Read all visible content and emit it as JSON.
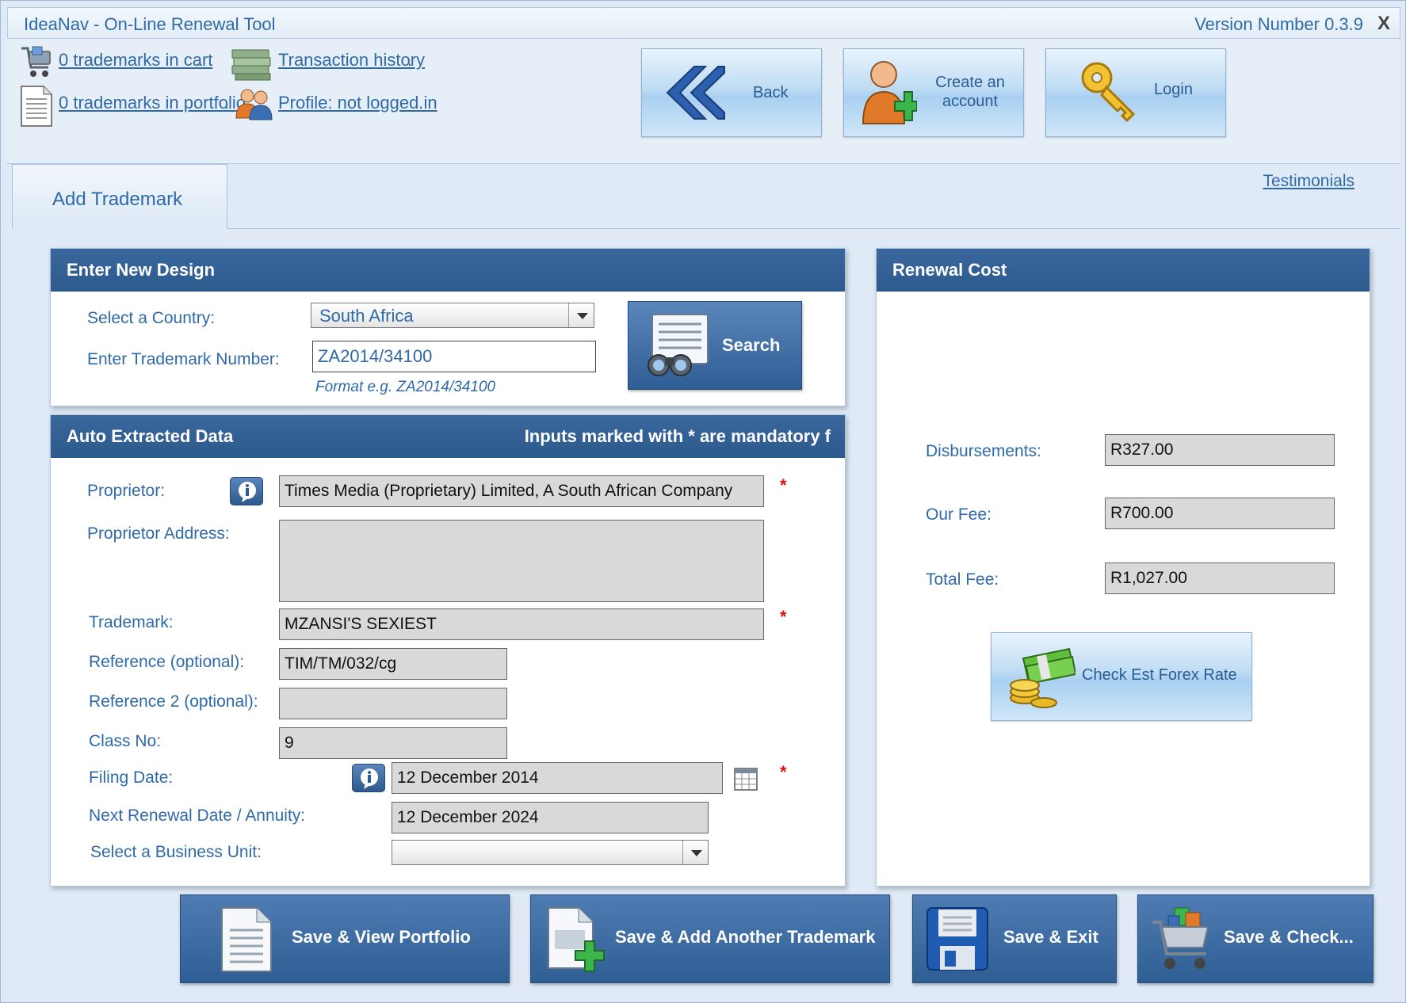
{
  "window": {
    "title": "IdeaNav - On-Line Renewal Tool",
    "version": "Version Number 0.3.9",
    "close": "X"
  },
  "top": {
    "cart_link": "0 trademarks in cart",
    "portfolio_link": "0 trademarks in portfolio",
    "history_link": "Transaction history",
    "profile_link": "Profile: not logged in",
    "back_label": "Back",
    "create_label_1": "Create an",
    "create_label_2": "account",
    "login_label": "Login"
  },
  "tabs": {
    "add_trademark": "Add Trademark",
    "testimonials": "Testimonials"
  },
  "design": {
    "title": "Enter New Design",
    "country_label": "Select a Country:",
    "country_value": "South Africa",
    "tm_label": "Enter Trademark Number:",
    "tm_value": "ZA2014/34100",
    "format_hint": "Format e.g. ZA2014/34100",
    "search_label": "Search"
  },
  "auto": {
    "title": "Auto Extracted Data",
    "mandatory_note": "Inputs marked with * are mandatory f",
    "proprietor_label": "Proprietor:",
    "proprietor_value": "Times Media (Proprietary) Limited, A South African Company",
    "address_label": "Proprietor Address:",
    "address_value": "",
    "trademark_label": "Trademark:",
    "trademark_value": "MZANSI'S SEXIEST",
    "ref_label": "Reference (optional):",
    "ref_value": "TIM/TM/032/cg",
    "ref2_label": "Reference 2 (optional):",
    "ref2_value": "",
    "class_label": "Class No:",
    "class_value": "9",
    "filing_label": "Filing Date:",
    "filing_value": "12 December 2014",
    "renewal_label": "Next Renewal Date / Annuity:",
    "renewal_value": "12 December 2024",
    "bu_label": "Select a Business Unit:",
    "bu_value": "",
    "star": "*"
  },
  "cost": {
    "title": "Renewal Cost",
    "disb_label": "Disbursements:",
    "disb_value": "R327.00",
    "fee_label": "Our Fee:",
    "fee_value": "R700.00",
    "total_label": "Total Fee:",
    "total_value": "R1,027.00",
    "forex_label": "Check Est Forex Rate"
  },
  "actions": {
    "save_view": "Save & View Portfolio",
    "save_add": "Save & Add Another Trademark",
    "save_exit": "Save & Exit",
    "save_check": "Save & Check..."
  }
}
